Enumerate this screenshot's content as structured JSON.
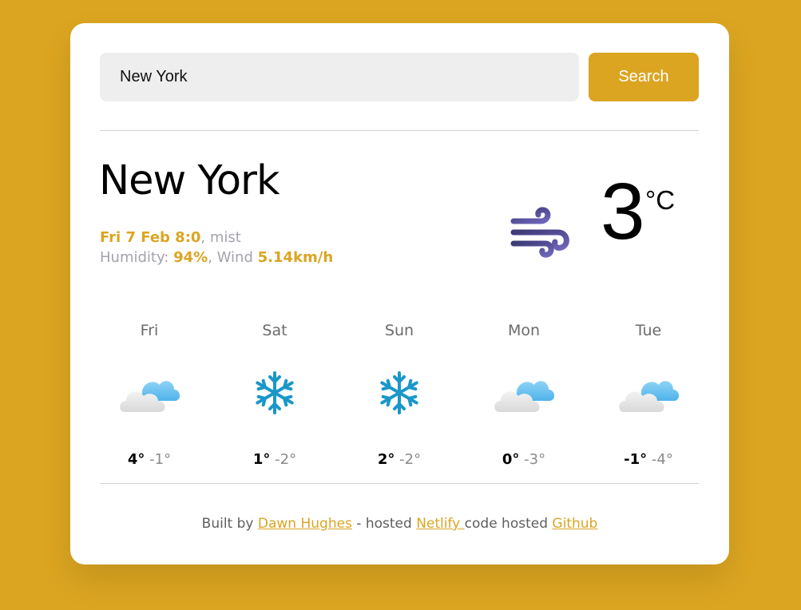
{
  "search": {
    "value": "New York",
    "button_label": "Search"
  },
  "current": {
    "city": "New York",
    "date_time": "Fri 7 Feb 8:0",
    "condition": "mist",
    "humidity_label": "Humidity: ",
    "humidity": "94%",
    "wind_label": "Wind ",
    "wind": "5.14km/h",
    "temperature": "3",
    "unit": "°C",
    "icon": "wind-icon"
  },
  "forecast": [
    {
      "day": "Fri",
      "max": "4°",
      "min": "-1°",
      "icon": "cloudy-icon"
    },
    {
      "day": "Sat",
      "max": "1°",
      "min": "-2°",
      "icon": "snowflake-icon"
    },
    {
      "day": "Sun",
      "max": "2°",
      "min": "-2°",
      "icon": "snowflake-icon"
    },
    {
      "day": "Mon",
      "max": "0°",
      "min": "-3°",
      "icon": "cloudy-icon"
    },
    {
      "day": "Tue",
      "max": "-1°",
      "min": "-4°",
      "icon": "cloudy-icon"
    }
  ],
  "footer": {
    "built_by_text": "Built by ",
    "author_link": "Dawn Hughes",
    "hosted_text": " - hosted ",
    "netlify_link": "Netlify ",
    "code_text": "code hosted ",
    "github_link": "Github"
  },
  "colors": {
    "background": "#dba521",
    "accent": "#dba521",
    "card": "#ffffff"
  }
}
